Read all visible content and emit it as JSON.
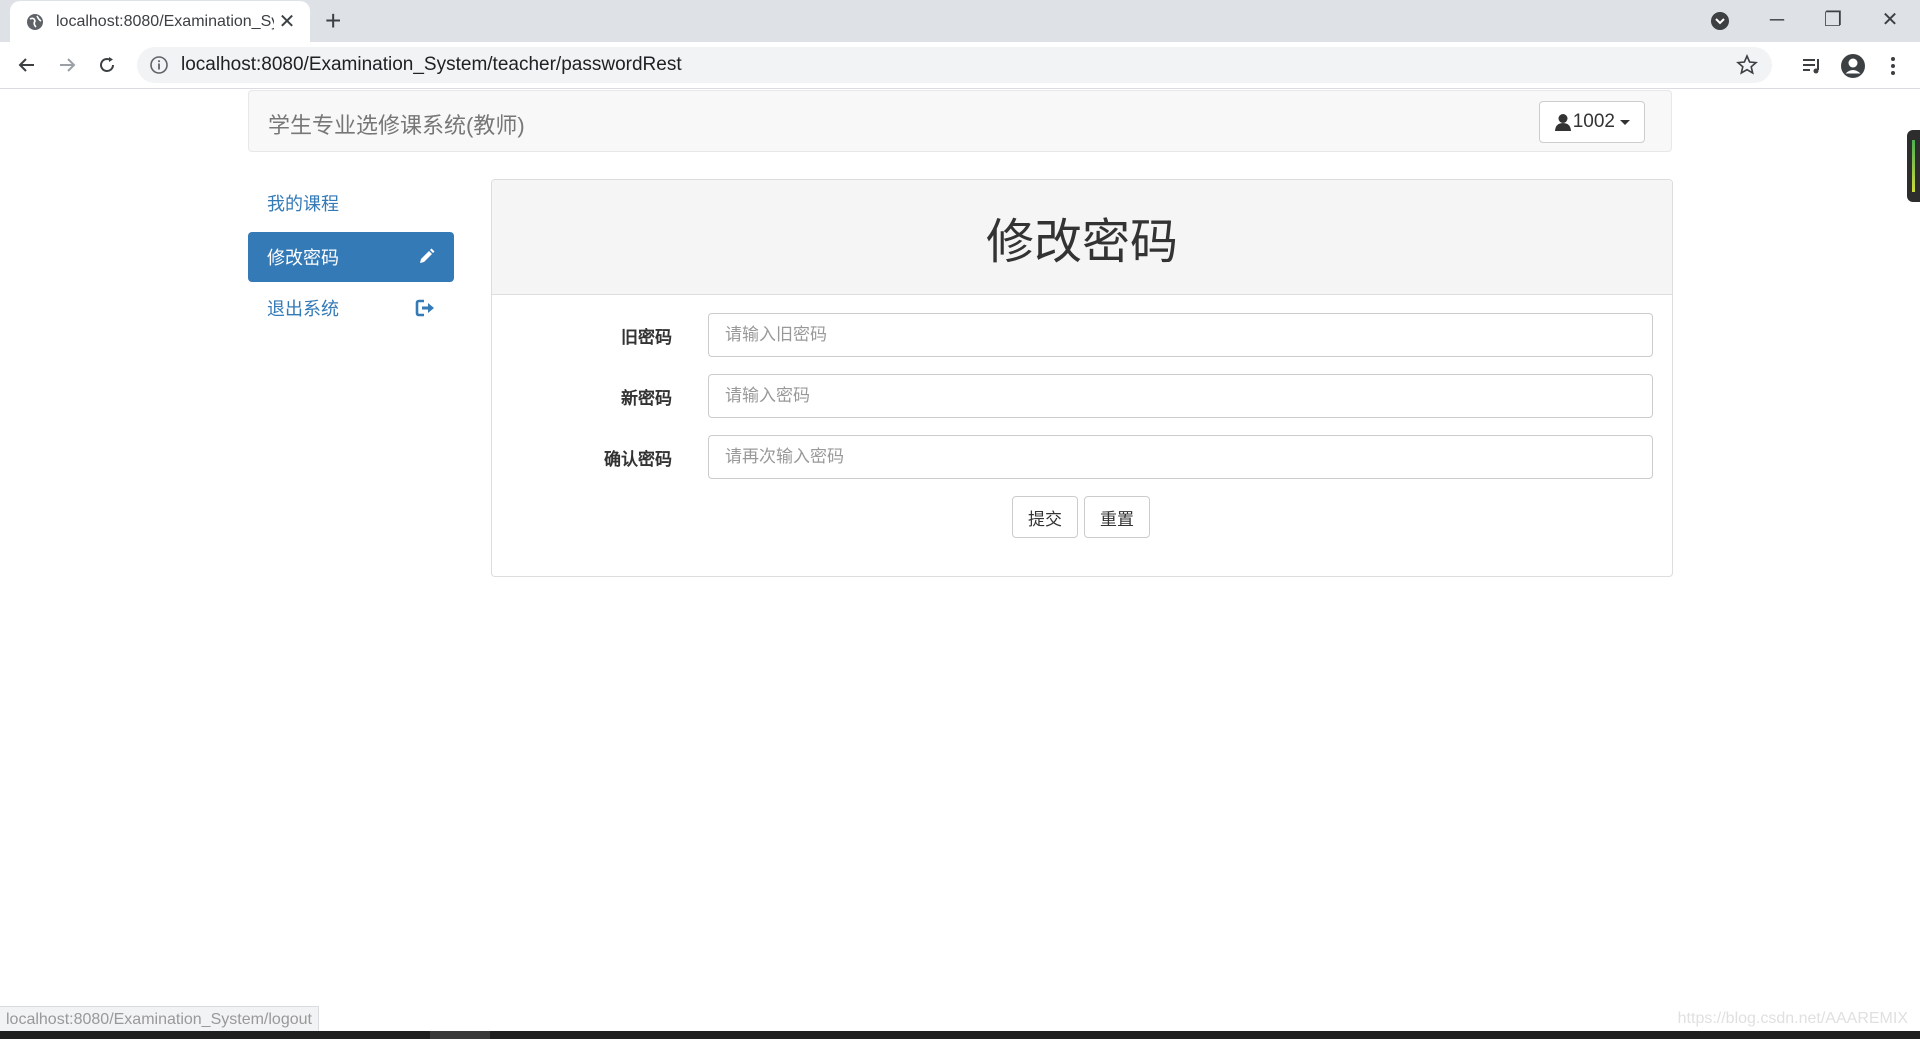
{
  "browser": {
    "tab_title": "localhost:8080/Examination_System",
    "url": "localhost:8080/Examination_System/teacher/passwordRest",
    "status_url": "localhost:8080/Examination_System/logout"
  },
  "navbar": {
    "brand": "学生专业选修课系统(教师)",
    "user": "1002"
  },
  "sidebar": {
    "items": [
      {
        "label": "我的课程",
        "icon": "",
        "active": false
      },
      {
        "label": "修改密码",
        "icon": "pencil-icon",
        "active": true
      },
      {
        "label": "退出系统",
        "icon": "logout-icon",
        "active": false
      }
    ]
  },
  "form": {
    "title": "修改密码",
    "old_password": {
      "label": "旧密码",
      "placeholder": "请输入旧密码",
      "value": ""
    },
    "new_password": {
      "label": "新密码",
      "placeholder": "请输入密码",
      "value": ""
    },
    "confirm_password": {
      "label": "确认密码",
      "placeholder": "请再次输入密码",
      "value": ""
    },
    "submit_label": "提交",
    "reset_label": "重置"
  },
  "watermark": "https://blog.csdn.net/AAAREMIX",
  "colors": {
    "primary": "#337ab7",
    "navbar_bg": "#f8f8f8",
    "panel_heading_bg": "#f5f5f5"
  }
}
